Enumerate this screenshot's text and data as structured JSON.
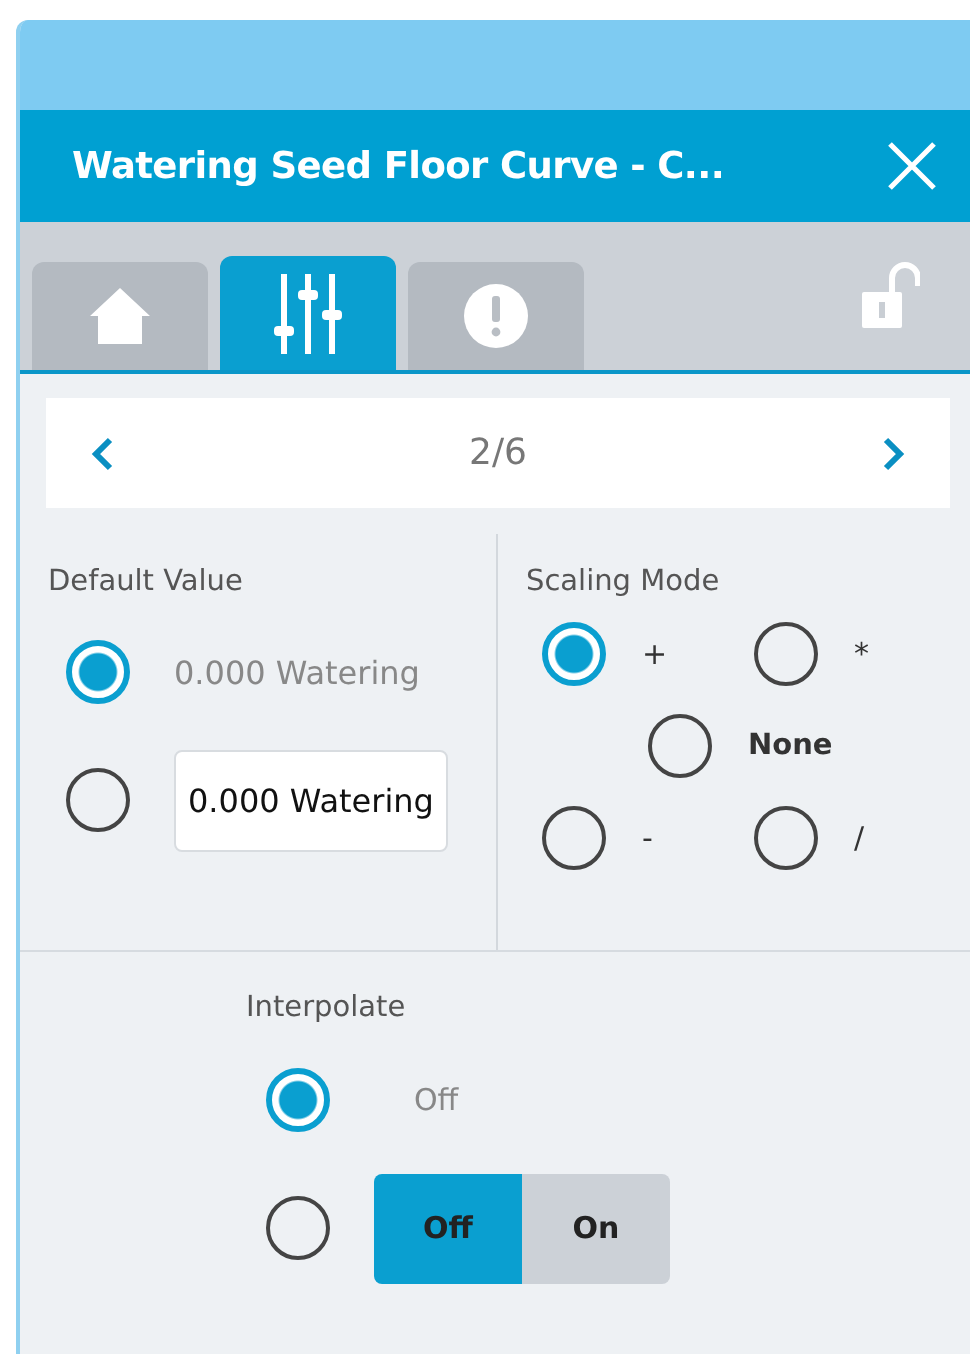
{
  "window": {
    "title": "Watering Seed Floor Curve - C..."
  },
  "tabs": [
    {
      "kind": "home",
      "selected": false
    },
    {
      "kind": "sliders",
      "selected": true
    },
    {
      "kind": "alert",
      "selected": false
    }
  ],
  "pager": {
    "label": "2/6"
  },
  "default_value": {
    "label": "Default Value",
    "options": [
      {
        "kind": "text",
        "value": "0.000 Watering",
        "selected": true
      },
      {
        "kind": "input",
        "value": "0.000 Watering",
        "selected": false
      }
    ]
  },
  "scaling_mode": {
    "label": "Scaling Mode",
    "rows": [
      [
        {
          "label": "+",
          "selected": true
        },
        {
          "label": "*",
          "selected": false
        }
      ],
      [
        {
          "label": "None",
          "selected": false
        }
      ],
      [
        {
          "label": "-",
          "selected": false
        },
        {
          "label": "/",
          "selected": false
        }
      ]
    ]
  },
  "interpolate": {
    "label": "Interpolate",
    "options": [
      {
        "kind": "text",
        "value": "Off",
        "selected": true
      },
      {
        "kind": "toggle",
        "selected": false,
        "segments": [
          {
            "label": "Off",
            "selected": true
          },
          {
            "label": "On",
            "selected": false
          }
        ]
      }
    ]
  }
}
